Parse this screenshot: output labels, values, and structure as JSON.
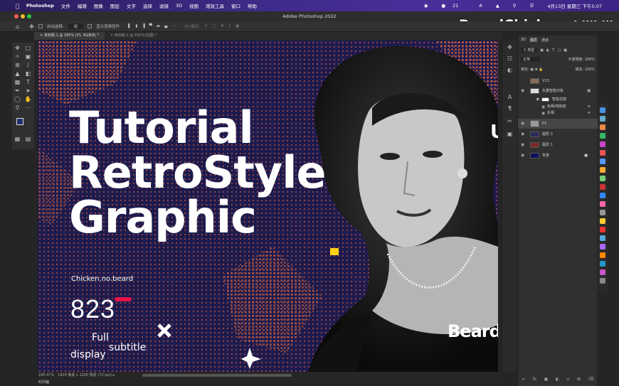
{
  "menubar": {
    "app": "Photoshop",
    "items": [
      "文件",
      "编辑",
      "图像",
      "图层",
      "文字",
      "选择",
      "滤镜",
      "3D",
      "视图",
      "增效工具",
      "窗口",
      "帮助"
    ],
    "date": "4月13日 星期三 下午5:07",
    "notif": "21"
  },
  "window": {
    "title": "Adobe Photoshop 2022"
  },
  "options": {
    "auto_select": "自动选择:",
    "auto_select_value": "组",
    "show_transform": "显示变换控件",
    "mode_3d": "3D 模式:"
  },
  "tabs": [
    {
      "label": "未标题-1 @ 185% (P1, RGB/8) *"
    },
    {
      "label": "未标题-2 @ 182%(位图) *"
    }
  ],
  "artwork": {
    "line1": "Tutorial",
    "line2": "RetroStyle",
    "line3": "Graphic",
    "tagline": "Chicken.no.beard",
    "number": "823",
    "sub1": "Full",
    "sub2": "subtitle",
    "sub3": "display",
    "beard_text": "Beard",
    "edge_letter": "U"
  },
  "status": {
    "zoom": "185.47%",
    "size": "1920 像素 x 1200 像素 (72 ppi)",
    "timeline": "时间轴"
  },
  "layers_panel": {
    "tabs": [
      "3D",
      "图层",
      "通道"
    ],
    "filter_kind": "类型",
    "blend_mode": "正常",
    "opacity_label": "不透明度:",
    "opacity_value": "100%",
    "lock_label": "锁定:",
    "fill_label": "填充:",
    "fill_value": "100%",
    "layers": [
      {
        "name": "V13"
      },
      {
        "name": "矢量智能对象"
      },
      {
        "name": "智能滤镜"
      },
      {
        "name": "色相/饱和度"
      },
      {
        "name": "反相"
      },
      {
        "name": "P1"
      },
      {
        "name": "图层 3"
      },
      {
        "name": "图层 1"
      },
      {
        "name": "背景"
      }
    ]
  },
  "watermark": {
    "text": "BeardChicken",
    "logo": "bilibili"
  },
  "colors": {
    "canvas_bg": "#1d1b4e",
    "dot_orange": "#ff6a3a",
    "accent_red": "#e8134a",
    "yellow": "#ffd21a"
  }
}
